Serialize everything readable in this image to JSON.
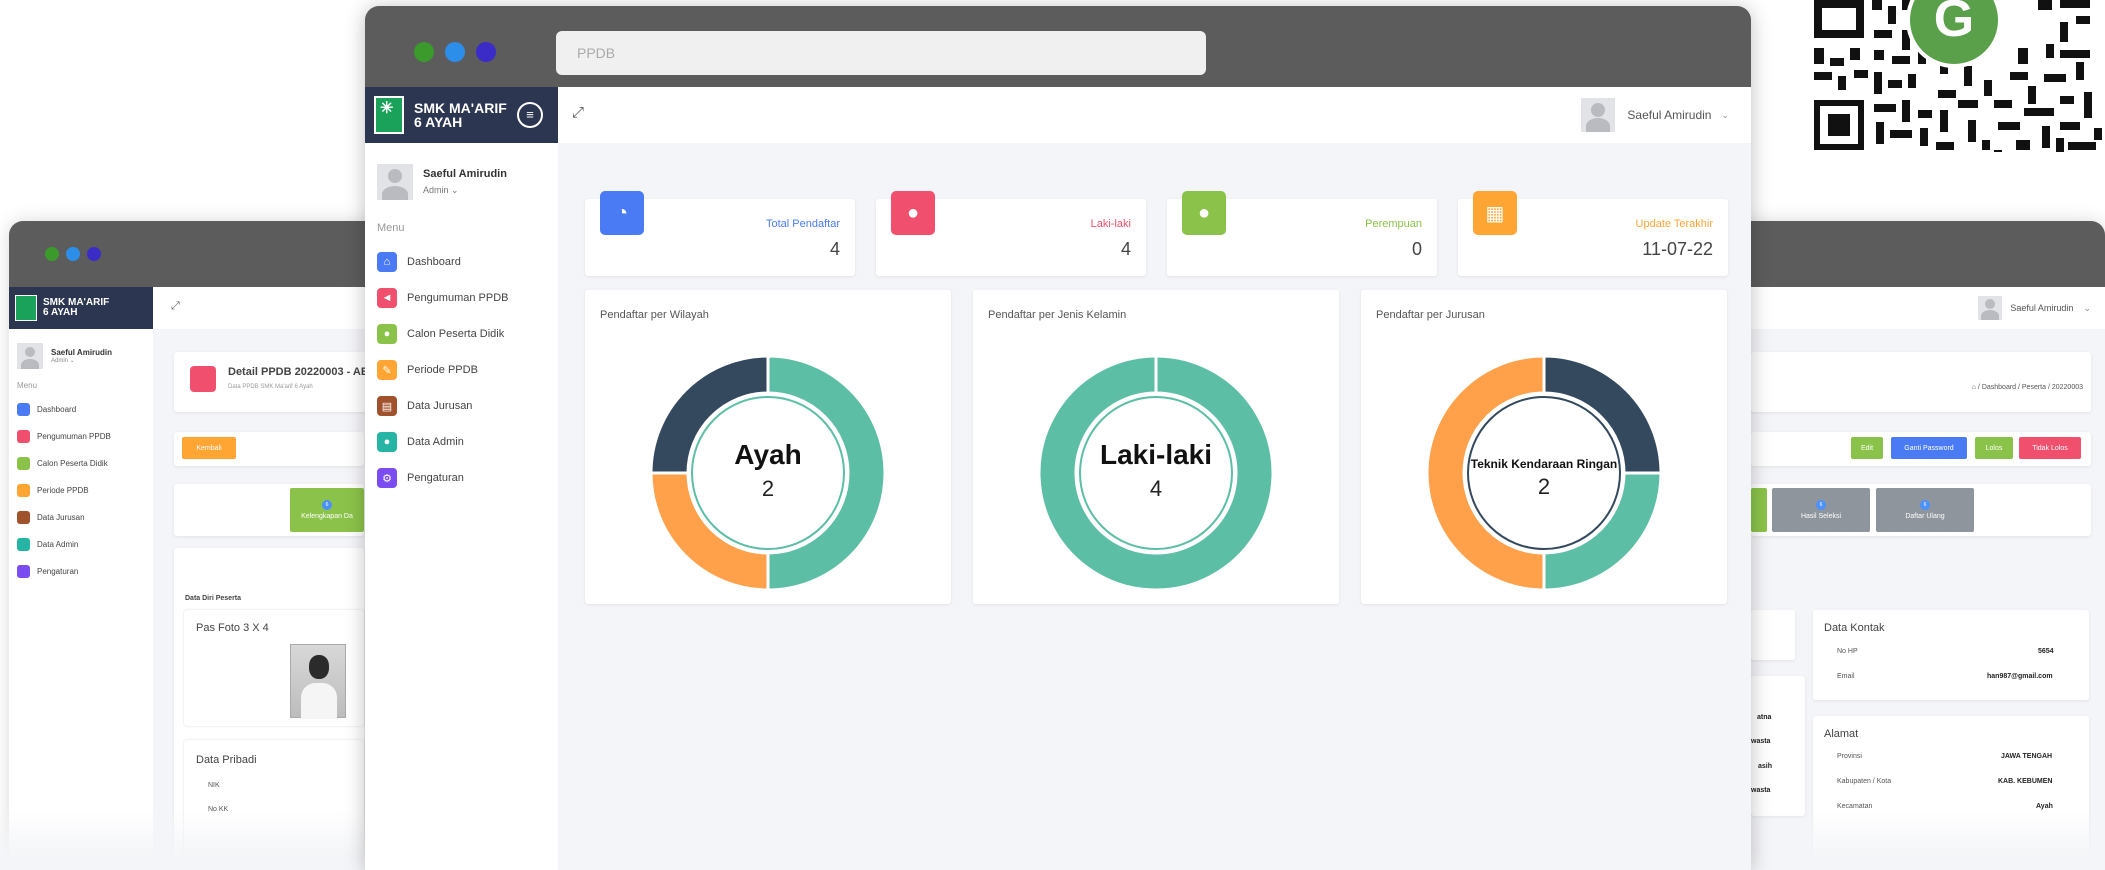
{
  "back": {
    "brand": [
      "SMK MA'ARIF",
      "6 AYAH"
    ],
    "user_name": "Saeful Amirudin",
    "user_role": "Admin",
    "menu_heading": "Menu",
    "menu": [
      "Dashboard",
      "Pengumuman PPDB",
      "Calon Peserta Didik",
      "Periode PPDB",
      "Data Jurusan",
      "Data Admin",
      "Pengaturan"
    ],
    "top_user": "Saeful Amirudin",
    "detail_title": "Detail PPDB 20220003 - AE",
    "detail_sub": "Data PPDB SMK Ma'arif 6 Ayah",
    "breadcrumb": "⌂  /  Dashboard  /  Peserta  /  20220003",
    "btn_kembali": "Kembali",
    "btn_edit": "Edit",
    "btn_ganti_password": "Ganti Password",
    "btn_lolos": "Lolos",
    "btn_tidak_lolos": "Tidak Lolos",
    "step_left": "Kelengkapan Da",
    "step_hasil": "Hasil Seleksi",
    "step_daftar": "Daftar Ulang",
    "step_badge": "6",
    "data_diri": "Data Diri Peserta",
    "pas_foto": "Pas Foto 3 X 4",
    "data_pribadi": "Data Pribadi",
    "nik": "NIK",
    "no_kk": "No KK",
    "data_kontak": "Data Kontak",
    "no_hp_label": "No HP",
    "no_hp_value": "5654",
    "email_label": "Email",
    "email_value": "han987@gmail.com",
    "alamat": "Alamat",
    "provinsi_label": "Provinsi",
    "provinsi_value": "JAWA TENGAH",
    "kabupaten_label": "Kabupaten / Kota",
    "kabupaten_value": "KAB. KEBUMEN",
    "kecamatan_label": "Kecamatan",
    "kecamatan_value": "Ayah",
    "partial": [
      "atna",
      "wasta",
      "asih",
      "wasta"
    ]
  },
  "front": {
    "url": "PPDB",
    "brand": [
      "SMK MA'ARIF",
      "6 AYAH"
    ],
    "user_name": "Saeful Amirudin",
    "user_role": "Admin",
    "menu_heading": "Menu",
    "menu": [
      {
        "label": "Dashboard",
        "icon": "home-icon",
        "color": "#4a7bf5"
      },
      {
        "label": "Pengumuman PPDB",
        "icon": "megaphone-icon",
        "color": "#f0506e"
      },
      {
        "label": "Calon Peserta Didik",
        "icon": "user-icon",
        "color": "#8bc34a"
      },
      {
        "label": "Periode PPDB",
        "icon": "edit-icon",
        "color": "#ffa534"
      },
      {
        "label": "Data Jurusan",
        "icon": "book-icon",
        "color": "#a0522d"
      },
      {
        "label": "Data Admin",
        "icon": "user-icon",
        "color": "#26b5a5"
      },
      {
        "label": "Pengaturan",
        "icon": "gear-icon",
        "color": "#7b4cf0"
      }
    ],
    "top_user": "Saeful Amirudin",
    "stats": [
      {
        "label": "Total Pendaftar",
        "value": "4",
        "color": "#4a7bf5",
        "icon": "pie-icon"
      },
      {
        "label": "Laki-laki",
        "value": "4",
        "color": "#f0506e",
        "icon": "user-icon"
      },
      {
        "label": "Perempuan",
        "value": "0",
        "color": "#8bc34a",
        "icon": "user-icon"
      },
      {
        "label": "Update Terakhir",
        "value": "11-07-22",
        "color": "#ffa534",
        "icon": "calendar-icon"
      }
    ]
  },
  "chart_data": [
    {
      "type": "pie",
      "title": "Pendaftar per Wilayah",
      "center_label": "Ayah",
      "center_value": "2",
      "colors": [
        "#5cbfa5",
        "#ffa04a",
        "#34495e"
      ],
      "values": [
        2,
        1,
        1
      ]
    },
    {
      "type": "pie",
      "title": "Pendaftar per Jenis Kelamin",
      "center_label": "Laki-laki",
      "center_value": "4",
      "colors": [
        "#5cbfa5",
        "#34495e"
      ],
      "values": [
        4,
        0
      ]
    },
    {
      "type": "pie",
      "title": "Pendaftar per Jurusan",
      "center_label": "Teknik Kendaraan Ringan",
      "center_value": "2",
      "colors": [
        "#34495e",
        "#5cbfa5",
        "#ffa04a"
      ],
      "values": [
        1,
        1,
        2
      ]
    }
  ]
}
